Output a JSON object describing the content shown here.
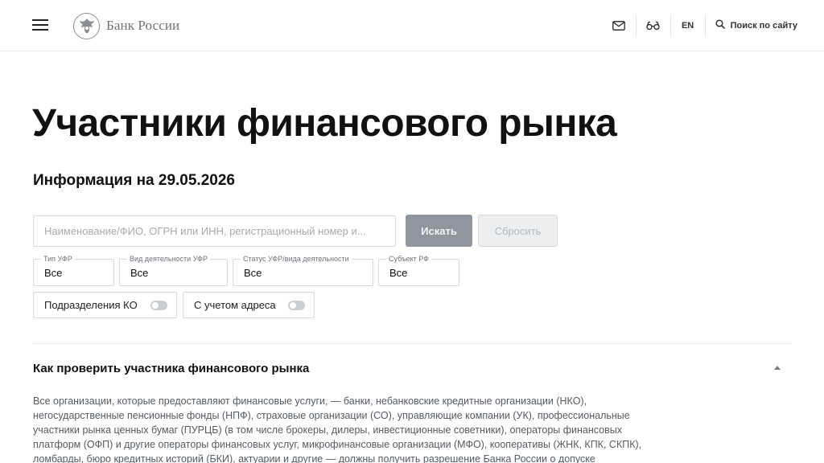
{
  "header": {
    "logo_text": "Банк России",
    "lang_label": "EN",
    "search_label": "Поиск по сайту",
    "icons": [
      "menu-icon",
      "bank-emblem-icon",
      "mail-icon",
      "glasses-icon",
      "search-icon"
    ]
  },
  "main": {
    "title": "Участники финансового рынка",
    "info_date": "Информация на 29.05.2026",
    "search": {
      "placeholder": "Наименование/ФИО, ОГРН или ИНН, регистрационный номер и...",
      "value": "",
      "search_button": "Искать",
      "reset_button": "Сбросить"
    },
    "filters": [
      {
        "label": "Тип УФР",
        "value": "Все"
      },
      {
        "label": "Вид деятельности УФР",
        "value": "Все"
      },
      {
        "label": "Статус УФР/вида деятельности",
        "value": "Все"
      },
      {
        "label": "Субъект РФ",
        "value": "Все"
      }
    ],
    "toggles": [
      {
        "label": "Подразделения КО",
        "checked": false
      },
      {
        "label": "С учетом адреса",
        "checked": false
      }
    ],
    "accordion": {
      "title": "Как проверить участника финансового рынка",
      "expanded": true,
      "body": "Все организации, которые предоставляют финансовые услуги, — банки, небанковские кредитные организации (НКО), негосударственные пенсионные фонды (НПФ), страховые организации (СО), управляющие компании (УК), профессиональные участники рынка ценных бумаг (ПУРЦБ) (в том числе брокеры, дилеры, инвестиционные советники), операторы финансовых платформ (ОФП) и другие операторы финансовых услуг, микрофинансовые организации (МФО), кооперативы (ЖНК, КПК, СКПК), ломбарды, бюро кредитных историй (БКИ), актуарии и другие — должны получить разрешение Банка России о допуске"
    }
  },
  "colors": {
    "primary_button": "#8f96a0",
    "disabled_button": "#eceef0",
    "border": "#d6d9dd",
    "text": "#111111",
    "muted_text": "#555b62"
  }
}
